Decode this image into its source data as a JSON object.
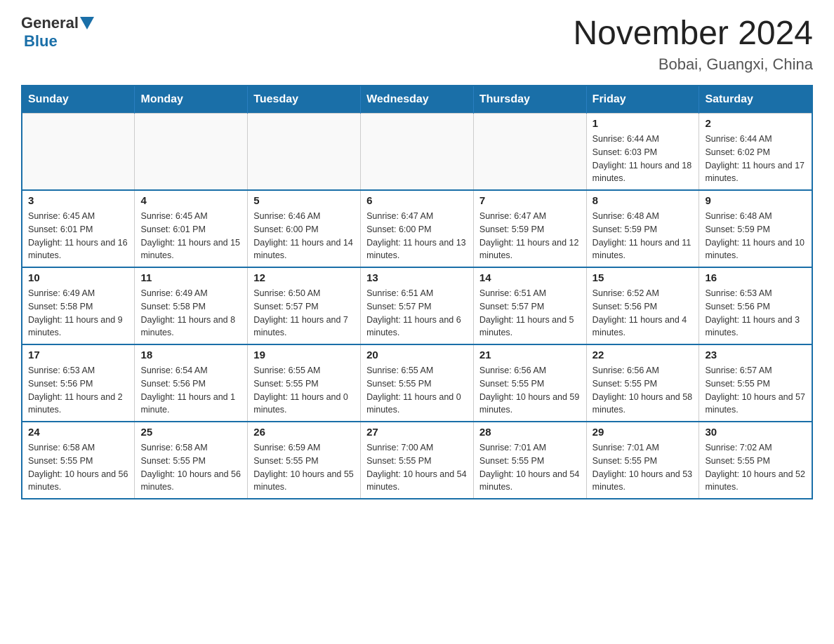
{
  "header": {
    "logo_general": "General",
    "logo_blue": "Blue",
    "title": "November 2024",
    "subtitle": "Bobai, Guangxi, China"
  },
  "days_of_week": [
    "Sunday",
    "Monday",
    "Tuesday",
    "Wednesday",
    "Thursday",
    "Friday",
    "Saturday"
  ],
  "weeks": [
    [
      {
        "day": "",
        "info": ""
      },
      {
        "day": "",
        "info": ""
      },
      {
        "day": "",
        "info": ""
      },
      {
        "day": "",
        "info": ""
      },
      {
        "day": "",
        "info": ""
      },
      {
        "day": "1",
        "info": "Sunrise: 6:44 AM\nSunset: 6:03 PM\nDaylight: 11 hours and 18 minutes."
      },
      {
        "day": "2",
        "info": "Sunrise: 6:44 AM\nSunset: 6:02 PM\nDaylight: 11 hours and 17 minutes."
      }
    ],
    [
      {
        "day": "3",
        "info": "Sunrise: 6:45 AM\nSunset: 6:01 PM\nDaylight: 11 hours and 16 minutes."
      },
      {
        "day": "4",
        "info": "Sunrise: 6:45 AM\nSunset: 6:01 PM\nDaylight: 11 hours and 15 minutes."
      },
      {
        "day": "5",
        "info": "Sunrise: 6:46 AM\nSunset: 6:00 PM\nDaylight: 11 hours and 14 minutes."
      },
      {
        "day": "6",
        "info": "Sunrise: 6:47 AM\nSunset: 6:00 PM\nDaylight: 11 hours and 13 minutes."
      },
      {
        "day": "7",
        "info": "Sunrise: 6:47 AM\nSunset: 5:59 PM\nDaylight: 11 hours and 12 minutes."
      },
      {
        "day": "8",
        "info": "Sunrise: 6:48 AM\nSunset: 5:59 PM\nDaylight: 11 hours and 11 minutes."
      },
      {
        "day": "9",
        "info": "Sunrise: 6:48 AM\nSunset: 5:59 PM\nDaylight: 11 hours and 10 minutes."
      }
    ],
    [
      {
        "day": "10",
        "info": "Sunrise: 6:49 AM\nSunset: 5:58 PM\nDaylight: 11 hours and 9 minutes."
      },
      {
        "day": "11",
        "info": "Sunrise: 6:49 AM\nSunset: 5:58 PM\nDaylight: 11 hours and 8 minutes."
      },
      {
        "day": "12",
        "info": "Sunrise: 6:50 AM\nSunset: 5:57 PM\nDaylight: 11 hours and 7 minutes."
      },
      {
        "day": "13",
        "info": "Sunrise: 6:51 AM\nSunset: 5:57 PM\nDaylight: 11 hours and 6 minutes."
      },
      {
        "day": "14",
        "info": "Sunrise: 6:51 AM\nSunset: 5:57 PM\nDaylight: 11 hours and 5 minutes."
      },
      {
        "day": "15",
        "info": "Sunrise: 6:52 AM\nSunset: 5:56 PM\nDaylight: 11 hours and 4 minutes."
      },
      {
        "day": "16",
        "info": "Sunrise: 6:53 AM\nSunset: 5:56 PM\nDaylight: 11 hours and 3 minutes."
      }
    ],
    [
      {
        "day": "17",
        "info": "Sunrise: 6:53 AM\nSunset: 5:56 PM\nDaylight: 11 hours and 2 minutes."
      },
      {
        "day": "18",
        "info": "Sunrise: 6:54 AM\nSunset: 5:56 PM\nDaylight: 11 hours and 1 minute."
      },
      {
        "day": "19",
        "info": "Sunrise: 6:55 AM\nSunset: 5:55 PM\nDaylight: 11 hours and 0 minutes."
      },
      {
        "day": "20",
        "info": "Sunrise: 6:55 AM\nSunset: 5:55 PM\nDaylight: 11 hours and 0 minutes."
      },
      {
        "day": "21",
        "info": "Sunrise: 6:56 AM\nSunset: 5:55 PM\nDaylight: 10 hours and 59 minutes."
      },
      {
        "day": "22",
        "info": "Sunrise: 6:56 AM\nSunset: 5:55 PM\nDaylight: 10 hours and 58 minutes."
      },
      {
        "day": "23",
        "info": "Sunrise: 6:57 AM\nSunset: 5:55 PM\nDaylight: 10 hours and 57 minutes."
      }
    ],
    [
      {
        "day": "24",
        "info": "Sunrise: 6:58 AM\nSunset: 5:55 PM\nDaylight: 10 hours and 56 minutes."
      },
      {
        "day": "25",
        "info": "Sunrise: 6:58 AM\nSunset: 5:55 PM\nDaylight: 10 hours and 56 minutes."
      },
      {
        "day": "26",
        "info": "Sunrise: 6:59 AM\nSunset: 5:55 PM\nDaylight: 10 hours and 55 minutes."
      },
      {
        "day": "27",
        "info": "Sunrise: 7:00 AM\nSunset: 5:55 PM\nDaylight: 10 hours and 54 minutes."
      },
      {
        "day": "28",
        "info": "Sunrise: 7:01 AM\nSunset: 5:55 PM\nDaylight: 10 hours and 54 minutes."
      },
      {
        "day": "29",
        "info": "Sunrise: 7:01 AM\nSunset: 5:55 PM\nDaylight: 10 hours and 53 minutes."
      },
      {
        "day": "30",
        "info": "Sunrise: 7:02 AM\nSunset: 5:55 PM\nDaylight: 10 hours and 52 minutes."
      }
    ]
  ]
}
